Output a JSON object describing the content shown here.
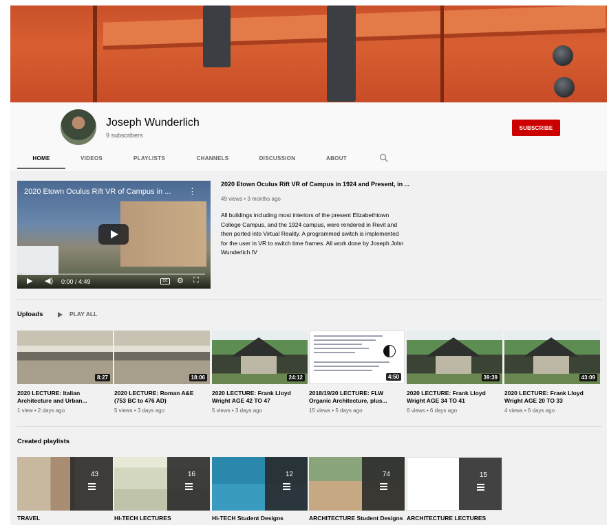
{
  "channel": {
    "name": "Joseph Wunderlich",
    "subscribers": "9 subscribers",
    "subscribe_label": "SUBSCRIBE"
  },
  "tabs": [
    "HOME",
    "VIDEOS",
    "PLAYLISTS",
    "CHANNELS",
    "DISCUSSION",
    "ABOUT"
  ],
  "active_tab": "HOME",
  "featured": {
    "overlay_title": "2020 Etown Oculus Rift VR of Campus in ...",
    "title": "2020 Etown Oculus Rift VR of Campus in 1924 and Present, in ...",
    "meta": "49 views • 3 months ago",
    "description": "All buildings including most interiors of the present Elizabethtown College Campus, and the 1924 campus, were rendered in Revit and then ported into Virtual Reality. A programmed switch is implemented for the user in VR to switch time frames. All work done by Joseph John Wunderlich IV",
    "time": "0:00 / 4:49"
  },
  "uploads": {
    "heading": "Uploads",
    "play_all": "PLAY ALL",
    "items": [
      {
        "title_1": "2020 LECTURE: Italian",
        "title_2": "Architecture and Urban...",
        "meta": "1 view • 2 days ago",
        "duration": "8:27",
        "thumb": "classroom"
      },
      {
        "title_1": "2020 LECTURE: Roman A&E",
        "title_2": "(753 BC to 476 AD)",
        "meta": "5 views • 3 days ago",
        "duration": "18:06",
        "thumb": "classroom"
      },
      {
        "title_1": "2020 LECTURE: Frank Lloyd",
        "title_2": "Wright AGE 42 TO 47",
        "meta": "5 views • 3 days ago",
        "duration": "24:12",
        "thumb": "house"
      },
      {
        "title_1": "2018/19/20 LECTURE: FLW",
        "title_2": "Organic Architecture, plus...",
        "meta": "15 views • 5 days ago",
        "duration": "4:50",
        "thumb": "document"
      },
      {
        "title_1": "2020 LECTURE: Frank Lloyd",
        "title_2": "Wright AGE 34 TO 41",
        "meta": "6 views • 6 days ago",
        "duration": "39:39",
        "thumb": "house"
      },
      {
        "title_1": "2020 LECTURE: Frank Lloyd",
        "title_2": "Wright AGE 20 TO 33",
        "meta": "4 views • 6 days ago",
        "duration": "43:09",
        "thumb": "house"
      }
    ]
  },
  "playlists": {
    "heading": "Created playlists",
    "items": [
      {
        "title": "TRAVEL",
        "count": "43",
        "color": "#b9a78e"
      },
      {
        "title": "HI-TECH LECTURES",
        "count": "16",
        "color": "#d8dcc4"
      },
      {
        "title": "HI-TECH Student Designs",
        "count": "12",
        "color": "#2f8db0"
      },
      {
        "title": "ARCHITECTURE Student Designs",
        "count": "74",
        "color": "#7c9a6e"
      },
      {
        "title": "ARCHITECTURE LECTURES",
        "count": "15",
        "color": "#ffffff"
      }
    ]
  }
}
